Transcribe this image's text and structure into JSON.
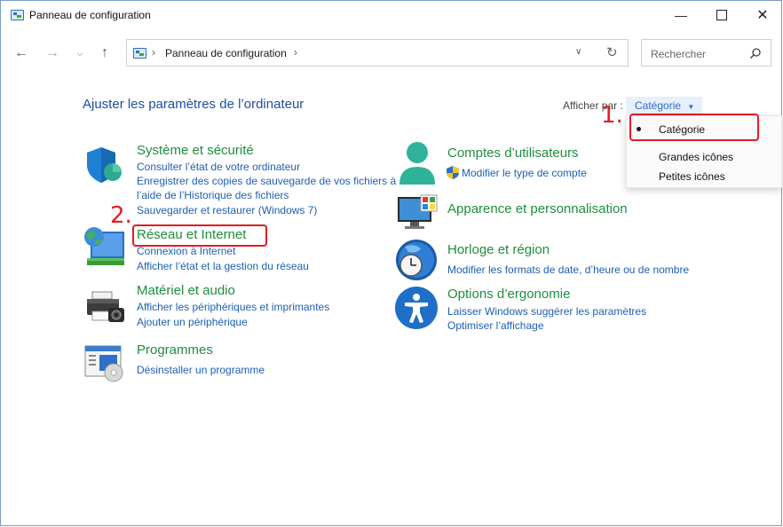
{
  "window": {
    "title": "Panneau de configuration"
  },
  "nav": {
    "breadcrumb_root": "Panneau de configuration"
  },
  "search": {
    "placeholder": "Rechercher"
  },
  "main": {
    "heading": "Ajuster les paramètres de l’ordinateur",
    "view_by_label": "Afficher par :",
    "view_by_value": "Catégorie"
  },
  "dropdown": {
    "options": [
      {
        "label": "Catégorie",
        "selected": true
      },
      {
        "label": "Grandes icônes",
        "selected": false
      },
      {
        "label": "Petites icônes",
        "selected": false
      }
    ]
  },
  "categories": {
    "system": {
      "title": "Système et sécurité",
      "links": [
        "Consulter l’état de votre ordinateur",
        "Enregistrer des copies de sauvegarde de vos fichiers à",
        "l’aide de l’Historique des fichiers",
        "Sauvegarder et restaurer (Windows 7)"
      ]
    },
    "network": {
      "title": "Réseau et Internet",
      "links": [
        "Connexion à Internet",
        "Afficher l’état et la gestion du réseau"
      ]
    },
    "hardware": {
      "title": "Matériel et audio",
      "links": [
        "Afficher les périphériques et imprimantes",
        "Ajouter un périphérique"
      ]
    },
    "programs": {
      "title": "Programmes",
      "links": [
        "Désinstaller un programme"
      ]
    },
    "accounts": {
      "title": "Comptes d’utilisateurs",
      "links": [
        "Modifier le type de compte"
      ]
    },
    "appearance": {
      "title": "Apparence et personnalisation"
    },
    "clock": {
      "title": "Horloge et région",
      "links": [
        "Modifier les formats de date, d’heure ou de nombre"
      ]
    },
    "ease": {
      "title": "Options d’ergonomie",
      "links": [
        "Laisser Windows suggérer les paramètres",
        "Optimiser l’affichage"
      ]
    }
  },
  "annotations": {
    "step1": "1.",
    "step2": "2."
  },
  "colors": {
    "link": "#1e5fb4",
    "category_title": "#1e8e3e",
    "heading": "#1e4fa0",
    "annotation": "#e41b23",
    "selected_view_bg": "#e8f0fb"
  },
  "icons": {
    "app": "control-panel-icon",
    "back": "arrow-left-icon",
    "forward": "arrow-right-icon",
    "recent": "chevron-down-icon",
    "up": "arrow-up-icon",
    "refresh": "refresh-icon",
    "search": "search-icon",
    "minimize": "minimize-icon",
    "maximize": "maximize-icon",
    "close": "close-icon"
  }
}
